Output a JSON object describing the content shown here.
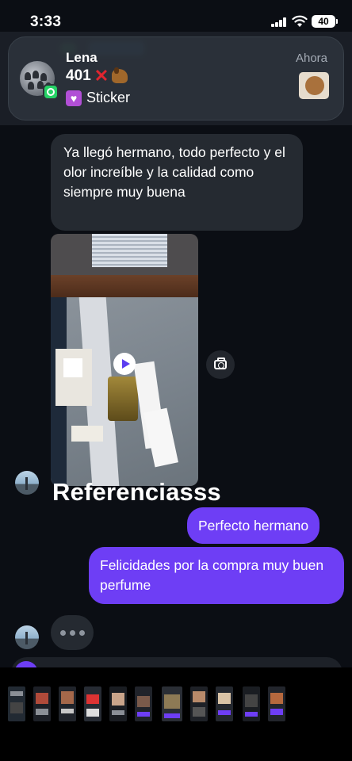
{
  "status_bar": {
    "time": "3:33",
    "battery": "40"
  },
  "notification": {
    "sender": "Lena",
    "line2": "401",
    "line3": "Sticker",
    "time": "Ahora"
  },
  "chat": {
    "incoming_text": "Ya llegó hermano, todo perfecto y el olor increíble y la calidad como siempre muy buena",
    "caption": "Referenciasss",
    "outgoing": [
      "Perfecto hermano",
      "Felicidades por la compra muy buen perfume"
    ]
  },
  "icons": {
    "messenger_app_badge": "whatsapp-icon",
    "camera": "camera-icon",
    "play": "play-icon",
    "typing": "typing-indicator-icon"
  },
  "colors": {
    "outgoing_bubble": "#6e3ef5",
    "incoming_bubble": "#252a31",
    "background": "#0b0e14",
    "whatsapp": "#25d366"
  }
}
